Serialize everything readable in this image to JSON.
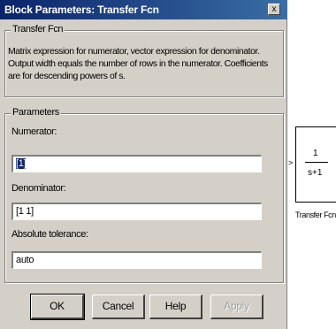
{
  "window": {
    "title": "Block Parameters: Transfer Fcn",
    "close_glyph": "x"
  },
  "description_group": {
    "legend": "Transfer Fcn",
    "text": "Matrix expression for numerator, vector expression for denominator. Output width equals the number of rows in the numerator.  Coefficients are for descending powers of s."
  },
  "parameters_group": {
    "legend": "Parameters",
    "fields": [
      {
        "label": "Numerator:",
        "value": "[1]"
      },
      {
        "label": "Denominator:",
        "value": "[1 1]"
      },
      {
        "label": "Absolute tolerance:",
        "value": "auto"
      }
    ]
  },
  "buttons": {
    "ok": "OK",
    "cancel": "Cancel",
    "help": "Help",
    "apply": "Apply"
  },
  "block": {
    "numerator": "1",
    "denominator": "s+1",
    "caption": "Transfer Fcn",
    "input_arrow": ">"
  },
  "colors": {
    "titlebar": "#0a246a",
    "dialog_face": "#d4d0c8",
    "selection": "#0a246a"
  }
}
